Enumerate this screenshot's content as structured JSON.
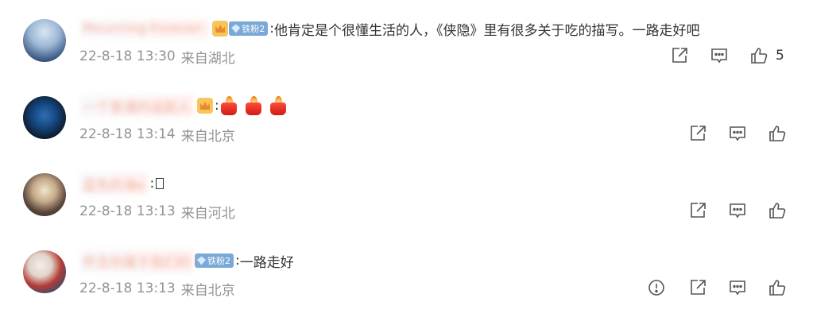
{
  "comments": [
    {
      "username": "Mourning-Forever·",
      "has_crown_badge": true,
      "fan_badge": "铁粉2",
      "text": "他肯定是个很懂生活的人，《侠隐》里有很多关于吃的描写。一路走好吧",
      "time": "22-8-18 13:30",
      "location": "来自湖北",
      "like_count": "5",
      "actions": [
        "share-icon",
        "comment-icon",
        "like-icon"
      ]
    },
    {
      "username": "一个普通的追剧人",
      "has_crown_badge": true,
      "fan_badge": "",
      "text": "",
      "emoji_count": 3,
      "emoji_name": "candle",
      "time": "22-8-18 13:14",
      "location": "来自北京",
      "like_count": "",
      "actions": [
        "share-icon",
        "comment-icon",
        "like-icon"
      ]
    },
    {
      "username": "蓝色的海e",
      "has_crown_badge": false,
      "fan_badge": "",
      "text": "",
      "time": "22-8-18 13:13",
      "location": "来自河北",
      "like_count": "",
      "actions": [
        "share-icon",
        "comment-icon",
        "like-icon"
      ]
    },
    {
      "username": "怀念你属于我们的",
      "has_crown_badge": false,
      "fan_badge": "铁粉2",
      "text": "一路走好",
      "time": "22-8-18 13:13",
      "location": "来自北京",
      "like_count": "",
      "actions": [
        "report-icon",
        "share-icon",
        "comment-icon",
        "like-icon"
      ]
    }
  ],
  "colors": {
    "meta_gray": "#939393",
    "text": "#333333",
    "icon_gray": "#555555",
    "fan_badge": "#7aa9d8"
  }
}
